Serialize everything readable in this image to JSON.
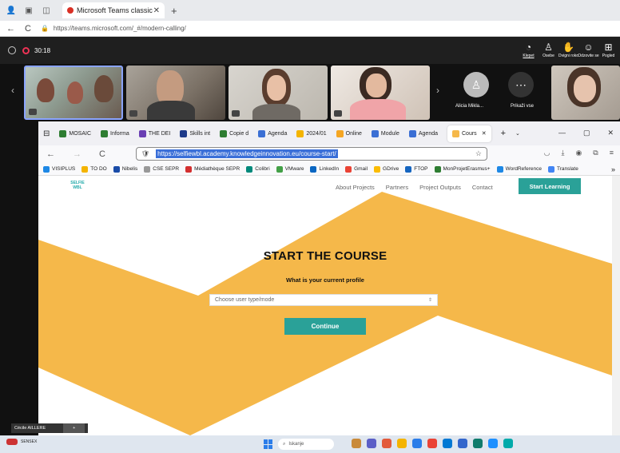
{
  "outer_browser": {
    "tab_title": "Microsoft Teams classic",
    "url": "https://teams.microsoft.com/_#/modern-calling/"
  },
  "teams": {
    "timer": "30:18",
    "actions": [
      {
        "icon": "chat-icon",
        "label": "Klepet"
      },
      {
        "icon": "people-icon",
        "label": "Osebe"
      },
      {
        "icon": "raise-hand-icon",
        "label": "Dvigni roko"
      },
      {
        "icon": "react-icon",
        "label": "Odzovite se"
      },
      {
        "icon": "view-icon",
        "label": "Pogled"
      }
    ],
    "participant_name": "Alicia Mikla...",
    "show_all_label": "Prikaži vse",
    "presenter_name": "Cécile AILLERE",
    "plus_label": "+"
  },
  "inner_browser": {
    "tabs": [
      "MOSAIC",
      "Informa",
      "THE DEI",
      "Skills int",
      "Copie d",
      "Agenda",
      "2024/01",
      "Online",
      "Module",
      "Agenda",
      "Cours"
    ],
    "url": "https://selfiewbl.academy.knowledgeinnovation.eu/course-start/",
    "bookmarks": [
      "VISIPLUS",
      "TO DO",
      "Nibelis",
      "CSE SEPR",
      "Médiathèque SEPR",
      "Colibri",
      "VMware",
      "LinkedIn",
      "Gmail",
      "GDrive",
      "FTOP",
      "MonProjetErasmus+",
      "WordReference",
      "Translate"
    ]
  },
  "site": {
    "logo_text": "SELFIE WBL",
    "nav": [
      "About Projects",
      "Partners",
      "Project Outputs",
      "Contact"
    ],
    "cta": "Start Learning",
    "title": "START THE COURSE",
    "subtitle": "What is your current profile",
    "select_placeholder": "Choose user type/mode",
    "continue_label": "Continue"
  },
  "taskbar": {
    "weather_label": "SENSEX",
    "search_placeholder": "Iskanje"
  },
  "colors": {
    "teal": "#2aa198",
    "orange": "#f5b84a",
    "teams_dark": "#1f1f1f"
  }
}
